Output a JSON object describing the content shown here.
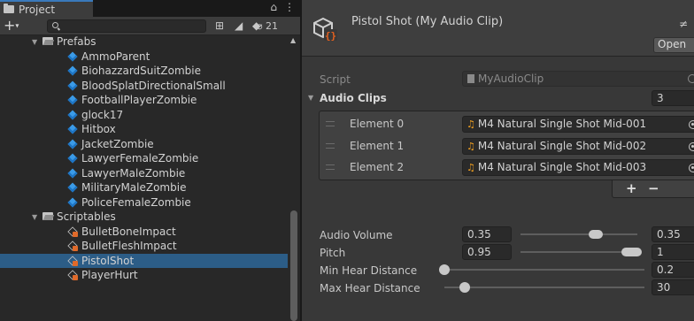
{
  "project": {
    "tab_label": "Project",
    "hidden_count": "21",
    "tree": [
      {
        "label": "Prefabs",
        "kind": "folder",
        "depth": 1
      },
      {
        "label": "AmmoParent",
        "kind": "prefab",
        "depth": 2
      },
      {
        "label": "BiohazzardSuitZombie",
        "kind": "prefab",
        "depth": 2
      },
      {
        "label": "BloodSplatDirectionalSmall",
        "kind": "prefab",
        "depth": 2
      },
      {
        "label": "FootballPlayerZombie",
        "kind": "prefab",
        "depth": 2
      },
      {
        "label": "glock17",
        "kind": "prefab",
        "depth": 2
      },
      {
        "label": "Hitbox",
        "kind": "prefab",
        "depth": 2
      },
      {
        "label": "JacketZombie",
        "kind": "prefab",
        "depth": 2
      },
      {
        "label": "LawyerFemaleZombie",
        "kind": "prefab",
        "depth": 2
      },
      {
        "label": "LawyerMaleZombie",
        "kind": "prefab",
        "depth": 2
      },
      {
        "label": "MilitaryMaleZombie",
        "kind": "prefab",
        "depth": 2
      },
      {
        "label": "PoliceFemaleZombie",
        "kind": "prefab",
        "depth": 2
      },
      {
        "label": "Scriptables",
        "kind": "folder",
        "depth": 1
      },
      {
        "label": "BulletBoneImpact",
        "kind": "scriptable",
        "depth": 2
      },
      {
        "label": "BulletFleshImpact",
        "kind": "scriptable",
        "depth": 2
      },
      {
        "label": "PistolShot",
        "kind": "scriptable",
        "depth": 2,
        "selected": true
      },
      {
        "label": "PlayerHurt",
        "kind": "scriptable",
        "depth": 2
      }
    ]
  },
  "inspector": {
    "title": "Pistol Shot (My Audio Clip)",
    "open_label": "Open",
    "script_label": "Script",
    "script_value": "MyAudioClip",
    "audio_clips_label": "Audio Clips",
    "audio_clips_size": "3",
    "elements": [
      {
        "label": "Element 0",
        "value": "M4 Natural Single Shot Mid-001"
      },
      {
        "label": "Element 1",
        "value": "M4 Natural Single Shot Mid-002"
      },
      {
        "label": "Element 2",
        "value": "M4 Natural Single Shot Mid-003"
      }
    ],
    "add_label": "+",
    "remove_label": "−",
    "volume": {
      "label": "Audio Volume",
      "min": "0.35",
      "max": "0.35",
      "min_frac": 0.62,
      "max_frac": 0.67
    },
    "pitch": {
      "label": "Pitch",
      "min": "0.95",
      "max": "1",
      "min_frac": 0.9,
      "max_frac": 1.0
    },
    "min_hear": {
      "label": "Min Hear Distance",
      "value": "0.2",
      "frac": 0.0
    },
    "max_hear": {
      "label": "Max Hear Distance",
      "value": "30",
      "frac": 0.1
    }
  },
  "colors": {
    "selection": "#2c5d87",
    "accent_tab": "#3a79bb",
    "prefab_icon": "#3b9be8",
    "audio_note": "#f0a020",
    "scriptable_badge": "#e06a2a"
  },
  "icons": {
    "tab": "folder-icon",
    "create": "plus-icon",
    "search": "search-icon",
    "audio": "music-note-icon",
    "asset": "scriptable-object-icon"
  }
}
